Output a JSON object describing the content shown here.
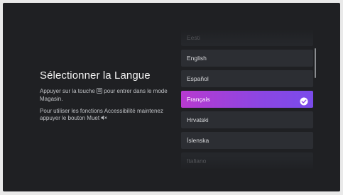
{
  "header": {
    "title": "Sélectionner la Langue"
  },
  "instructions": {
    "store_mode_before": "Appuyer sur la touche",
    "store_mode_after": "pour entrer dans le mode Magasin.",
    "accessibility_text": "Pour utiliser les fonctions Accessibilité maintenez appuyer le bouton Muet"
  },
  "icons": {
    "menu_button": "menu-button-icon",
    "mute": "mute-icon",
    "check": "checkmark-icon"
  },
  "colors": {
    "background": "#1f2023",
    "item_bg": "#2c2e33",
    "selected_start": "#b73ad0",
    "selected_end": "#7a4bea"
  },
  "languages": {
    "items": [
      {
        "label": "Eesti"
      },
      {
        "label": "English"
      },
      {
        "label": "Español"
      },
      {
        "label": "Français",
        "selected": true
      },
      {
        "label": "Hrvatski"
      },
      {
        "label": "Íslenska"
      },
      {
        "label": "Italiano"
      }
    ]
  }
}
